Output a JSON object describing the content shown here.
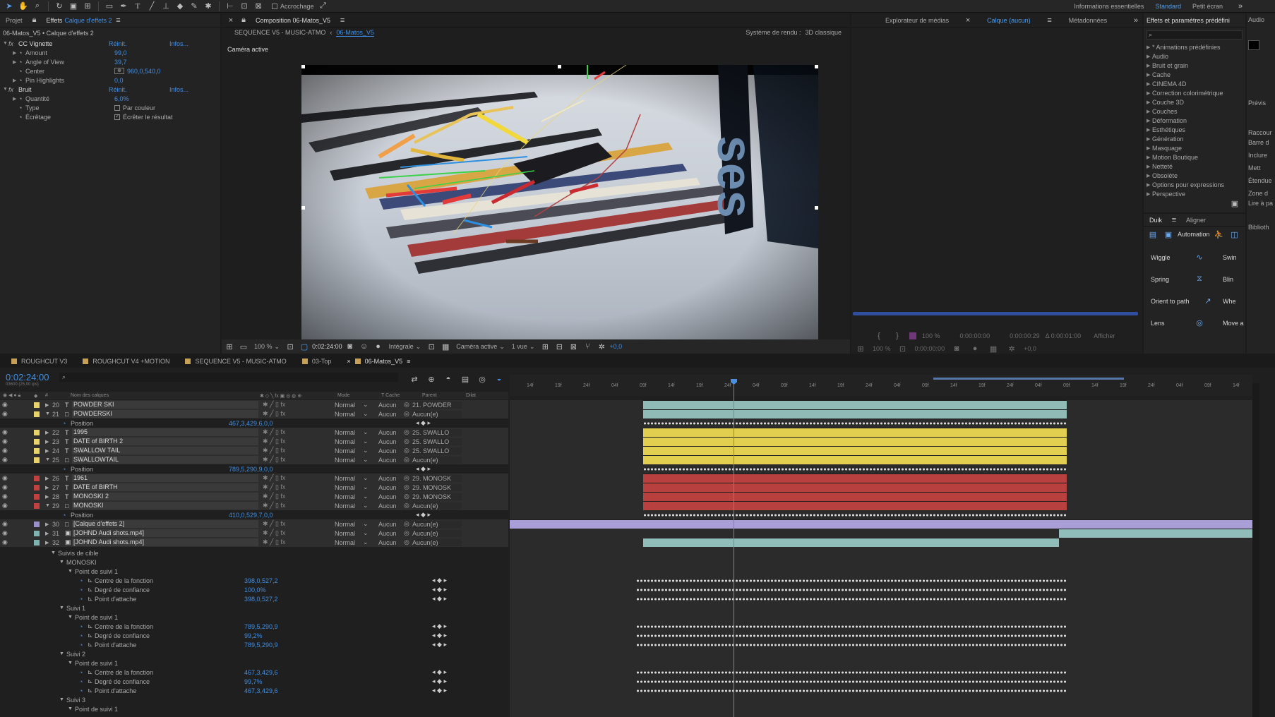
{
  "toolbar": {
    "snap_label": "Accrochage",
    "workspaces": [
      "Informations essentielles",
      "Standard",
      "Petit écran"
    ]
  },
  "left_panel": {
    "tabs": [
      "Projet",
      "Effets",
      "Calque d'effets 2"
    ],
    "breadcrumb": "06-Matos_V5 • Calque d'effets 2",
    "effects": [
      {
        "name": "CC Vignette",
        "value": "Réinit.",
        "extra": "Infos..."
      },
      {
        "name": "Amount",
        "value": "99,0"
      },
      {
        "name": "Angle of View",
        "value": "39,7"
      },
      {
        "name": "Center",
        "value": "960,0,540,0"
      },
      {
        "name": "Pin Highlights",
        "value": "0,0"
      },
      {
        "name": "Bruit",
        "value": "Réinit.",
        "extra": "Infos..."
      },
      {
        "name": "Quantité",
        "value": "6,0%"
      },
      {
        "name": "Type",
        "value": "Par couleur"
      },
      {
        "name": "Écrêtage",
        "value": "Écrêter le résultat"
      }
    ]
  },
  "comp_panel": {
    "tab": "Composition 06-Matos_V5",
    "breadcrumbs": [
      "SEQUENCE V5 - MUSIC-ATMO",
      "06-Matos_V5"
    ],
    "renderer_label": "Système de rendu :",
    "renderer_value": "3D classique",
    "camera_label": "Caméra active",
    "bottom": {
      "zoom": "100 %",
      "timecode": "0:02:24:00",
      "resolution": "Intégrale",
      "camera": "Caméra active",
      "views": "1 vue",
      "exposure": "+0,0"
    }
  },
  "media_panel": {
    "tabs": [
      "Explorateur de médias",
      "Calque (aucun)",
      "Métadonnées"
    ],
    "zoom": "100 %",
    "time1": "0:00:00:00",
    "time2": "0:00:00:29",
    "time3": "Δ 0:00:01:00",
    "show": "Afficher",
    "exposure": "+0,0"
  },
  "fx_presets": {
    "title": "Effets et paramètres prédéfini",
    "items": [
      "* Animations prédéfinies",
      "Audio",
      "Bruit et grain",
      "Cache",
      "CINEMA 4D",
      "Correction colorimétrique",
      "Couche 3D",
      "Couches",
      "Déformation",
      "Esthétiques",
      "Génération",
      "Masquage",
      "Motion Boutique",
      "Netteté",
      "Obsolète",
      "Options pour expressions",
      "Perspective"
    ]
  },
  "duik": {
    "tabs": [
      "Duik",
      "Aligner"
    ],
    "automation": "Automation",
    "buttons": [
      [
        "Wiggle",
        "Swin"
      ],
      [
        "Spring",
        "Blin"
      ],
      [
        "Orient to path",
        "Whe"
      ],
      [
        "Lens",
        "Move a"
      ]
    ]
  },
  "right_strip": {
    "items": [
      "Audio",
      "Prévis",
      "Raccour",
      "Barre d",
      "Inclure",
      "Mett",
      "Étendue",
      "Zone d",
      "Lire à pa",
      "Biblioth"
    ]
  },
  "timeline": {
    "tabs": [
      "ROUGHCUT V3",
      "ROUGHCUT V4 +MOTION",
      "SEQUENCE V5 - MUSIC-ATMO",
      "03-Top",
      "06-Matos_V5"
    ],
    "timecode": "0:02:24:00",
    "frames": "03600 (25,00 ips)",
    "headers": {
      "name": "Nom des calques",
      "mode": "Mode",
      "track": "T  Cache",
      "parent": "Parent",
      "stretch": "Dilat"
    },
    "ruler": [
      "14f",
      "19f",
      "24f",
      "04f",
      "09f",
      "14f",
      "19f",
      "24f",
      "04f",
      "09f",
      "14f",
      "19f",
      "24f",
      "04f",
      "09f",
      "14f",
      "19f",
      "24f",
      "04f",
      "09f",
      "14f",
      "19f",
      "24f",
      "04f",
      "09f",
      "14f"
    ],
    "layers": [
      {
        "num": "20",
        "name": "POWDER SKI",
        "icon": "T",
        "label": "#e8d26a",
        "mode": "Normal",
        "track": "Aucun",
        "parent": "21. POWDER"
      },
      {
        "num": "21",
        "name": "POWDERSKI",
        "icon": "□",
        "label": "#e8d26a",
        "mode": "Normal",
        "track": "Aucun",
        "parent": "Aucun(e)"
      },
      {
        "num": "",
        "name": "Position",
        "icon": "",
        "label": "",
        "mode": "",
        "track": "",
        "parent": "",
        "value": "467,3,429,6,0,0",
        "prop": true
      },
      {
        "num": "22",
        "name": "1995",
        "icon": "T",
        "label": "#e8d26a",
        "mode": "Normal",
        "track": "Aucun",
        "parent": "25. SWALLO"
      },
      {
        "num": "23",
        "name": "DATE of BIRTH 2",
        "icon": "T",
        "label": "#e8d26a",
        "mode": "Normal",
        "track": "Aucun",
        "parent": "25. SWALLO"
      },
      {
        "num": "24",
        "name": "SWALLOW TAIL",
        "icon": "T",
        "label": "#e8d26a",
        "mode": "Normal",
        "track": "Aucun",
        "parent": "25. SWALLO"
      },
      {
        "num": "25",
        "name": "SWALLOWTAIL",
        "icon": "□",
        "label": "#e8d26a",
        "mode": "Normal",
        "track": "Aucun",
        "parent": "Aucun(e)"
      },
      {
        "num": "",
        "name": "Position",
        "icon": "",
        "label": "",
        "mode": "",
        "track": "",
        "parent": "",
        "value": "789,5,290,9,0,0",
        "prop": true
      },
      {
        "num": "26",
        "name": "1961",
        "icon": "T",
        "label": "#c0413f",
        "mode": "Normal",
        "track": "Aucun",
        "parent": "29. MONOSK"
      },
      {
        "num": "27",
        "name": "DATE of BIRTH",
        "icon": "T",
        "label": "#c0413f",
        "mode": "Normal",
        "track": "Aucun",
        "parent": "29. MONOSK"
      },
      {
        "num": "28",
        "name": "MONOSKI 2",
        "icon": "T",
        "label": "#c0413f",
        "mode": "Normal",
        "track": "Aucun",
        "parent": "29. MONOSK"
      },
      {
        "num": "29",
        "name": "MONOSKI",
        "icon": "□",
        "label": "#c0413f",
        "mode": "Normal",
        "track": "Aucun",
        "parent": "Aucun(e)"
      },
      {
        "num": "",
        "name": "Position",
        "icon": "",
        "label": "",
        "mode": "",
        "track": "",
        "parent": "",
        "value": "410,0,529,7,0,0",
        "prop": true
      },
      {
        "num": "30",
        "name": "[Calque d'effets 2]",
        "icon": "□",
        "label": "#9a8fc8",
        "mode": "Normal",
        "track": "Aucun",
        "parent": "Aucun(e)"
      },
      {
        "num": "31",
        "name": "[JOHND Audi shots.mp4]",
        "icon": "▣",
        "label": "#7fb3b0",
        "mode": "Normal",
        "track": "Aucun",
        "parent": "Aucun(e)"
      },
      {
        "num": "32",
        "name": "[JOHND Audi shots.mp4]",
        "icon": "▣",
        "label": "#7fb3b0",
        "mode": "Normal",
        "track": "Aucun",
        "parent": "Aucun(e)"
      }
    ],
    "tracking": [
      {
        "t": "Suivis de cible",
        "lvl": 0
      },
      {
        "t": "MONOSKI",
        "lvl": 1
      },
      {
        "t": "Point de suivi 1",
        "lvl": 2
      },
      {
        "t": "Centre de la fonction",
        "lvl": 3,
        "v": "398,0,527,2"
      },
      {
        "t": "Degré de confiance",
        "lvl": 3,
        "v": "100,0%"
      },
      {
        "t": "Point d'attache",
        "lvl": 3,
        "v": "398,0,527,2"
      },
      {
        "t": "Suivi 1",
        "lvl": 1
      },
      {
        "t": "Point de suivi 1",
        "lvl": 2
      },
      {
        "t": "Centre de la fonction",
        "lvl": 3,
        "v": "789,5,290,9"
      },
      {
        "t": "Degré de confiance",
        "lvl": 3,
        "v": "99,2%"
      },
      {
        "t": "Point d'attache",
        "lvl": 3,
        "v": "789,5,290,9"
      },
      {
        "t": "Suivi 2",
        "lvl": 1
      },
      {
        "t": "Point de suivi 1",
        "lvl": 2
      },
      {
        "t": "Centre de la fonction",
        "lvl": 3,
        "v": "467,3,429,6"
      },
      {
        "t": "Degré de confiance",
        "lvl": 3,
        "v": "99,7%"
      },
      {
        "t": "Point d'attache",
        "lvl": 3,
        "v": "467,3,429,6"
      },
      {
        "t": "Suivi 3",
        "lvl": 1
      },
      {
        "t": "Point de suivi 1",
        "lvl": 2
      }
    ]
  },
  "colors": {
    "accent": "#3f8fe6",
    "yellow": "#e3cf4f",
    "red": "#b8403e",
    "teal": "#90bdb9",
    "lavender": "#a99fd6",
    "playhead": "#4a90e2"
  },
  "icons": [
    "selection-tool-icon",
    "hand-tool-icon",
    "zoom-tool-icon",
    "rotate-tool-icon",
    "camera-tool-icon",
    "pan-behind-icon",
    "rectangle-tool-icon",
    "pen-tool-icon",
    "text-tool-icon",
    "brush-tool-icon",
    "clone-stamp-icon",
    "eraser-icon",
    "roto-brush-icon",
    "puppet-pin-icon"
  ]
}
